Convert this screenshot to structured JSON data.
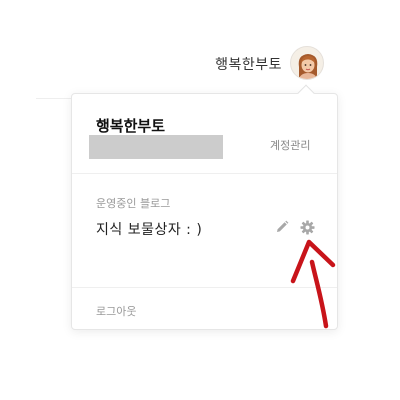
{
  "header": {
    "username": "행복한부토",
    "avatar_icon": "avatar-portrait-icon"
  },
  "account": {
    "name": "행복한부토",
    "manage_label": "계정관리"
  },
  "blogs": {
    "section_title": "운영중인 블로그",
    "items": [
      {
        "name": "지식 보물상자 : )",
        "edit_icon": "pencil-icon",
        "settings_icon": "gear-icon"
      }
    ]
  },
  "footer": {
    "logout_label": "로그아웃"
  },
  "colors": {
    "annotation": "#c8141a",
    "muted_text": "#999999",
    "redaction": "#cccccc"
  }
}
